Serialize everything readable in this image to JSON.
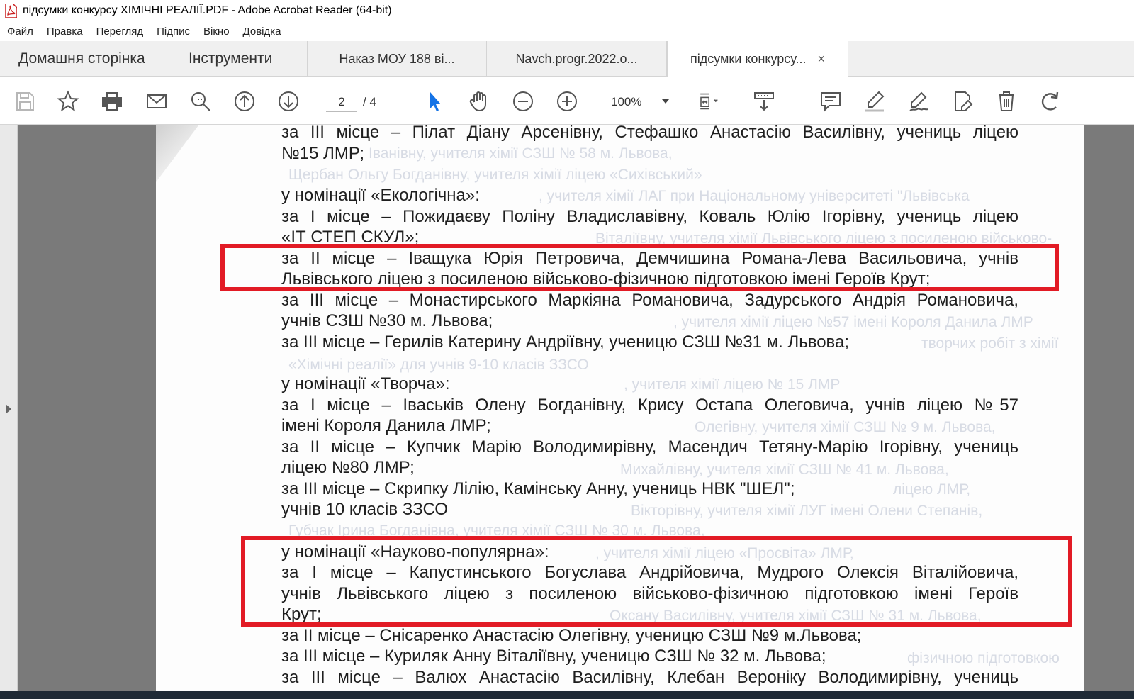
{
  "window": {
    "title": "підсумки конкурсу ХІМІЧНІ РЕАЛІЇ.PDF - Adobe Acrobat Reader (64-bit)"
  },
  "menu": [
    "Файл",
    "Правка",
    "Перегляд",
    "Підпис",
    "Вікно",
    "Довідка"
  ],
  "tabs": {
    "home": "Домашня сторінка",
    "tools": "Інструменти",
    "docs": [
      {
        "label": "Наказ МОУ 188 ві..."
      },
      {
        "label": "Navch.progr.2022.o..."
      },
      {
        "label": "підсумки конкурсу..."
      }
    ],
    "close_glyph": "×"
  },
  "toolbar": {
    "page_current": "2",
    "page_total": "/ 4",
    "zoom": "100%"
  },
  "document": {
    "lines": [
      "за ІІІ місце – Пілат Діану Арсенівну, Стефашко Анастасію Василівну, учениць ліцею",
      "№15 ЛМР;",
      "у номінації «Екологічна»:",
      "за І місце – Пожидаєву Поліну Владиславівну, Коваль Юлію Ігорівну, учениць ліцею",
      "«ІТ СТЕП СКУЛ»;",
      "за ІІ місце – Іващука Юрія Петровича, Демчишина Романа-Лева Васильовича, учнів",
      "Львівського ліцею з посиленою військово-фізичною підготовкою  імені Героїв Крут;",
      "за ІІІ місце – Монастирського Маркіяна Романовича, Задурського Андрія Романовича,",
      "учнів СЗШ №30 м. Львова;",
      "за ІІІ місце – Герилів Катерину Андріївну, ученицю СЗШ №31 м. Львова;",
      "у номінації «Творча»:",
      "за І місце – Іваськів  Олену Богданівну,  Крису Остапа Олеговича, учнів ліцею №57",
      "імені Короля Данила ЛМР;",
      "за ІІ місце – Купчик Марію Володимирівну, Масендич Тетяну-Марію Ігорівну, учениць",
      "ліцею №80 ЛМР;",
      "за ІІІ місце – Скрипку Лілію, Камінську Анну, учениць НВК \"ШЕЛ\";",
      "учнів 10 класів ЗЗСО",
      "у номінації «Науково-популярна»:",
      "за І місце – Капустинського Богуслава Андрійовича, Мудрого Олексія Віталійовича,",
      "учнів Львівського ліцею з посиленою військово-фізичною підготовкою імені Героїв",
      "Крут;",
      "за ІІ місце – Снісаренко Анастасію Олегівну, ученицю СЗШ №9 м.Львова;",
      "за ІІІ місце – Куриляк Анну Віталіївну, ученицю СЗШ № 32 м. Львова;",
      "за ІІІ місце – Валюх Анастасію Василівну, Клебан Вероніку Володимирівну, учениць"
    ],
    "bleed_through": [
      "Іванівну, учителя хімії СЗШ № 58 м. Львова,",
      "Щербан Ольгу Богданівну, учителя хімії ліцею «Сихівський»",
      ", учителя хімії ЛАГ при Національному університеті \"Львівська",
      "Віталіївну, учителя хімії Львівського ліцею з посиленою військово-",
      ", учителя хімії ліцею №57 імені Короля Данила ЛМР",
      "творчих робіт з хімії",
      "«Хімічні реалії» для учнів 9-10 класів ЗЗСО",
      ", учителя хімії ліцею № 15 ЛМР",
      "Олегівну, учителя хімії СЗШ № 9 м. Львова,",
      "Михайлівну, учителя хімії СЗШ № 41 м. Львова,",
      "ліцею ЛМР,",
      "Вікторівну, учителя хімії ЛУГ імені Олени Степанів,",
      "Губчак Ірина Богданівна, учителя хімії СЗШ № 30 м. Львова,",
      ", учителя хімії ліцею «Просвіта» ЛМР,",
      "Оксану Василівну, учителя хімії СЗШ № 31 м. Львова,",
      "фізичною підготовкою"
    ]
  }
}
